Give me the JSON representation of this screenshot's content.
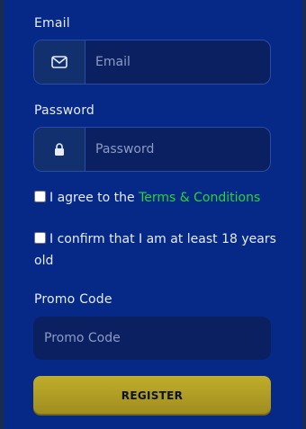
{
  "form": {
    "email": {
      "label": "Email",
      "placeholder": "Email",
      "icon": "mail-icon"
    },
    "password": {
      "label": "Password",
      "placeholder": "Password",
      "icon": "lock-icon"
    },
    "terms": {
      "text": "I agree to the ",
      "link": "Terms & Conditions"
    },
    "age": {
      "text": "I confirm that I am at least 18 years old"
    },
    "promo": {
      "label": "Promo Code",
      "placeholder": "Promo Code"
    },
    "register_label": "REGISTER"
  },
  "colors": {
    "panel": "#062886",
    "input_bg": "#0a2060",
    "link": "#29d33a",
    "button": "#b09d25"
  }
}
